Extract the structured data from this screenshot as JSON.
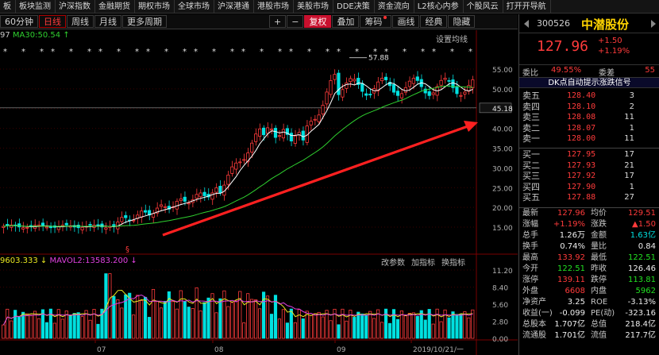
{
  "top_menu": [
    "板",
    "板块监测",
    "沪深指数",
    "金融期货",
    "期权市场",
    "全球市场",
    "沪深港通",
    "港股市场",
    "美股市场",
    "DDE决策",
    "资金流向",
    "L2核心内参",
    "个股风云",
    "打开开导航"
  ],
  "toolbar": {
    "periods": [
      "60分钟",
      "日线",
      "周线",
      "月线",
      "更多周期"
    ],
    "active_period": "日线",
    "zoom_in": "+",
    "zoom_out": "−",
    "fq_label": "复权",
    "tools": [
      "叠加",
      "筹码",
      "画线",
      "经典",
      "隐藏"
    ],
    "chip_label": "筹码"
  },
  "main_legend": {
    "prefix": "97",
    "ma30": "MA30:50.54",
    "arrow": "↑"
  },
  "settings_label": "设置均线",
  "vol_legend": {
    "v1": "9603.333",
    "v1_arrow": "↓",
    "v2": "MAVOL2:13583.200",
    "v2_arrow": "↓"
  },
  "vol_buttons": [
    "改参数",
    "加指标",
    "换指标"
  ],
  "price_axis": [
    "55.00",
    "50.00",
    "45.00",
    "40.00",
    "35.00",
    "30.00",
    "25.00",
    "20.00",
    "15.00"
  ],
  "current_price_tag": "45.18",
  "vol_axis": [
    "11.20",
    "8.40",
    "5.60",
    "2.80",
    "0.00"
  ],
  "date_axis": [
    "07",
    "08",
    "09",
    "2019/10/21/一"
  ],
  "peak_label": "57.88",
  "s_marker": "§",
  "quote": {
    "code": "300526",
    "name": "中潜股份",
    "price": "127.96",
    "change": "+1.50",
    "change_pct": "+1.19%",
    "ratio_label": "委比",
    "ratio_value": "49.55%",
    "diff_label": "委差",
    "diff_value": "55",
    "signal": "DK点自动提示涨跌信号",
    "sells": [
      {
        "label": "卖五",
        "price": "128.40",
        "vol": "3"
      },
      {
        "label": "卖四",
        "price": "128.10",
        "vol": "2"
      },
      {
        "label": "卖三",
        "price": "128.08",
        "vol": "11"
      },
      {
        "label": "卖二",
        "price": "128.07",
        "vol": "1"
      },
      {
        "label": "卖一",
        "price": "128.00",
        "vol": "11"
      }
    ],
    "buys": [
      {
        "label": "买一",
        "price": "127.95",
        "vol": "17"
      },
      {
        "label": "买二",
        "price": "127.93",
        "vol": "21"
      },
      {
        "label": "买三",
        "price": "127.92",
        "vol": "17"
      },
      {
        "label": "买四",
        "price": "127.90",
        "vol": "1"
      },
      {
        "label": "买五",
        "price": "127.88",
        "vol": "27"
      }
    ],
    "stats": [
      {
        "k1": "最新",
        "v1": "127.96",
        "c1": "red",
        "k2": "均价",
        "v2": "129.51",
        "c2": "red"
      },
      {
        "k1": "涨幅",
        "v1": "+1.19%",
        "c1": "red",
        "k2": "涨跌",
        "v2": "▲1.50",
        "c2": "red"
      },
      {
        "k1": "总手",
        "v1": "1.26万",
        "c1": "white",
        "k2": "金额",
        "v2": "1.63亿",
        "c2": "cyan"
      },
      {
        "k1": "换手",
        "v1": "0.74%",
        "c1": "white",
        "k2": "量比",
        "v2": "0.84",
        "c2": "white"
      },
      {
        "k1": "最高",
        "v1": "133.92",
        "c1": "red",
        "k2": "最低",
        "v2": "122.51",
        "c2": "green"
      },
      {
        "k1": "今开",
        "v1": "122.51",
        "c1": "green",
        "k2": "昨收",
        "v2": "126.46",
        "c2": "white"
      },
      {
        "k1": "涨停",
        "v1": "139.11",
        "c1": "red",
        "k2": "跌停",
        "v2": "113.81",
        "c2": "green"
      },
      {
        "k1": "外盘",
        "v1": "6608",
        "c1": "red",
        "k2": "内盘",
        "v2": "5962",
        "c2": "green"
      },
      {
        "k1": "净资产",
        "v1": "3.25",
        "c1": "white",
        "k2": "ROE",
        "v2": "-3.13%",
        "c2": "white"
      },
      {
        "k1": "收益(一)",
        "v1": "-0.099",
        "c1": "white",
        "k2": "PE(动)",
        "v2": "-323.16",
        "c2": "white"
      },
      {
        "k1": "总股本",
        "v1": "1.707亿",
        "c1": "white",
        "k2": "总值",
        "v2": "218.4亿",
        "c2": "white"
      },
      {
        "k1": "流通股",
        "v1": "1.701亿",
        "c1": "white",
        "k2": "流值",
        "v2": "217.7亿",
        "c2": "white"
      }
    ]
  },
  "colors": {
    "up": "#ff3b3b",
    "down": "#00e0e0",
    "ma_white": "#ffffff",
    "ma_green": "#2fd02f",
    "trend_arrow": "#ff2020",
    "brand": "#ffd400"
  }
}
